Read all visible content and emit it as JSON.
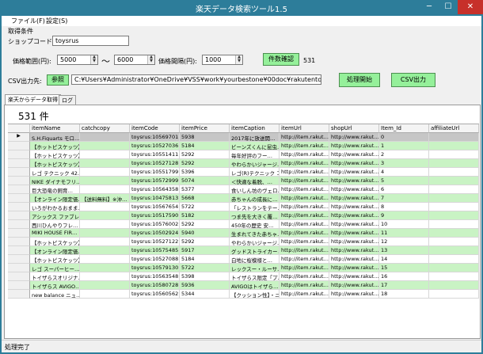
{
  "window": {
    "title": "楽天データ検索ツール1.5"
  },
  "menu": {
    "file": "ファイル(F)",
    "settings": "設定(S)"
  },
  "form": {
    "section_label": "取得条件",
    "shop_code_label": "ショップコード:",
    "shop_code_value": "toysrus",
    "price_range_label": "価格範囲(円):",
    "price_min": "5000",
    "price_sep": "〜",
    "price_max": "6000",
    "price_step_label": "価格間隔(円):",
    "price_step": "1000",
    "count_check_button": "件数確認",
    "count_check_result": "531",
    "csv_dest_label": "CSV出力先:",
    "browse_button": "参照",
    "csv_path": "C:¥Users¥Administrator¥OneDrive¥VSS¥work¥yourbestone¥00doc¥rakutentools",
    "start_button": "処理開始",
    "csv_output_button": "CSV出力"
  },
  "tabs": [
    "楽天からデータ取得",
    "ログ"
  ],
  "result": {
    "count_label": "531 件"
  },
  "grid": {
    "columns": [
      "itemName",
      "catchcopy",
      "itemCode",
      "itemPrice",
      "itemCaption",
      "itemUrl",
      "shopUrl",
      "Item_Id",
      "affiliateUrl"
    ],
    "rows": [
      {
        "itemName": "S.H.Figuarts モロ…",
        "catchcopy": "",
        "itemCode": "toysrus:10569701",
        "itemPrice": "5938",
        "itemCaption": "2017年に放送開…",
        "itemUrl": "http://item.rakut…",
        "shopUrl": "http://www.rakut…",
        "id": "0"
      },
      {
        "itemName": "【ホットピスケッツ】…",
        "catchcopy": "",
        "itemCode": "toysrus:10527036",
        "itemPrice": "5184",
        "itemCaption": "ビーンズくんに昆虫…",
        "itemUrl": "http://item.rakut…",
        "shopUrl": "http://www.rakut…",
        "id": "1"
      },
      {
        "itemName": "【ホットピスケッツ】…",
        "catchcopy": "",
        "itemCode": "toysrus:10551411",
        "itemPrice": "5292",
        "itemCaption": "毎年好評のフー…",
        "itemUrl": "http://item.rakut…",
        "shopUrl": "http://www.rakut…",
        "id": "2"
      },
      {
        "itemName": "【ホットピスケッツ】…",
        "catchcopy": "",
        "itemCode": "toysrus:10527128",
        "itemPrice": "5292",
        "itemCaption": "やわらかいジャージ…",
        "itemUrl": "http://item.rakut…",
        "shopUrl": "http://www.rakut…",
        "id": "3"
      },
      {
        "itemName": "レゴ テクニック 42…",
        "catchcopy": "",
        "itemCode": "toysrus:10551799",
        "itemPrice": "5396",
        "itemCaption": "レゴ(R)テクニック コ…",
        "itemUrl": "http://item.rakut…",
        "shopUrl": "http://www.rakut…",
        "id": "4"
      },
      {
        "itemName": "NIKE ダイナモフリ…",
        "catchcopy": "",
        "itemCode": "toysrus:10572999",
        "itemPrice": "5074",
        "itemCaption": "＜快適な着脱、…",
        "itemUrl": "http://item.rakut…",
        "shopUrl": "http://www.rakut…",
        "id": "5"
      },
      {
        "itemName": "巨大恐竜の飼育…",
        "catchcopy": "",
        "itemCode": "toysrus:10564358",
        "itemPrice": "5377",
        "itemCaption": "食いしん坊のヴェロ…",
        "itemUrl": "http://item.rakut…",
        "shopUrl": "http://www.rakut…",
        "id": "6"
      },
      {
        "itemName": "【オンライン限定価…",
        "catchcopy": "【送料無料】※沖…",
        "itemCode": "toysrus:10475813",
        "itemPrice": "5668",
        "itemCaption": "赤ちゃんの成長に…",
        "itemUrl": "http://item.rakut…",
        "shopUrl": "http://www.rakut…",
        "id": "7"
      },
      {
        "itemName": "いろがわかるおまま…",
        "catchcopy": "",
        "itemCode": "toysrus:10567654",
        "itemPrice": "5722",
        "itemCaption": "「レストランをテー…",
        "itemUrl": "http://item.rakut…",
        "shopUrl": "http://www.rakut…",
        "id": "8"
      },
      {
        "itemName": "アシックス ファブレ…",
        "catchcopy": "",
        "itemCode": "toysrus:10517590",
        "itemPrice": "5182",
        "itemCaption": "つま先を大きく覆…",
        "itemUrl": "http://item.rakut…",
        "shopUrl": "http://www.rakut…",
        "id": "9"
      },
      {
        "itemName": "西川ひんやりフレ…",
        "catchcopy": "",
        "itemCode": "toysrus:10576002",
        "itemPrice": "5292",
        "itemCaption": "450年の歴史 安…",
        "itemUrl": "http://item.rakut…",
        "shopUrl": "http://www.rakut…",
        "id": "10"
      },
      {
        "itemName": "MIKI HOUSE FIR…",
        "catchcopy": "",
        "itemCode": "toysrus:10502924",
        "itemPrice": "5940",
        "itemCaption": "生まれてきた赤ちゃ…",
        "itemUrl": "http://item.rakut…",
        "shopUrl": "http://www.rakut…",
        "id": "11"
      },
      {
        "itemName": "【ホットピスケッツ】…",
        "catchcopy": "",
        "itemCode": "toysrus:10527122",
        "itemPrice": "5292",
        "itemCaption": "やわらかいジャージ…",
        "itemUrl": "http://item.rakut…",
        "shopUrl": "http://www.rakut…",
        "id": "12"
      },
      {
        "itemName": "【オンライン限定価…",
        "catchcopy": "",
        "itemCode": "toysrus:10575485",
        "itemPrice": "5917",
        "itemCaption": "グッドストライカーと…",
        "itemUrl": "http://item.rakut…",
        "shopUrl": "http://www.rakut…",
        "id": "13"
      },
      {
        "itemName": "【ホットピスケッツ】…",
        "catchcopy": "",
        "itemCode": "toysrus:10527088",
        "itemPrice": "5184",
        "itemCaption": "白地に桜模様と…",
        "itemUrl": "http://item.rakut…",
        "shopUrl": "http://www.rakut…",
        "id": "14"
      },
      {
        "itemName": "レゴ スーパーヒー…",
        "catchcopy": "",
        "itemCode": "toysrus:10579130",
        "itemPrice": "5722",
        "itemCaption": "レックスー・ルーサ…",
        "itemUrl": "http://item.rakut…",
        "shopUrl": "http://www.rakut…",
        "id": "15"
      },
      {
        "itemName": "トイザらスオリジナ…",
        "catchcopy": "",
        "itemCode": "toysrus:10563548",
        "itemPrice": "5398",
        "itemCaption": "トイザらス限定「プ…",
        "itemUrl": "http://item.rakut…",
        "shopUrl": "http://www.rakut…",
        "id": "16"
      },
      {
        "itemName": "トイザらス AVIGO…",
        "catchcopy": "",
        "itemCode": "toysrus:10580728",
        "itemPrice": "5936",
        "itemCaption": "AVIGOはトイザら…",
        "itemUrl": "http://item.rakut…",
        "shopUrl": "http://www.rakut…",
        "id": "17"
      },
      {
        "itemName": "new balance ニュ…",
        "catchcopy": "",
        "itemCode": "toysrus:10560562",
        "itemPrice": "5344",
        "itemCaption": "【クッション性】・ニュ…",
        "itemUrl": "http://item.rakut…",
        "shopUrl": "http://www.rakut…",
        "id": "18"
      }
    ]
  },
  "status": {
    "text": "処理完了"
  },
  "colors": {
    "titlebar": "#2d7d9a",
    "accent_button": "#95f09a",
    "row_alt": "#c9f3c4",
    "row_selected": "#c6c6c6"
  }
}
